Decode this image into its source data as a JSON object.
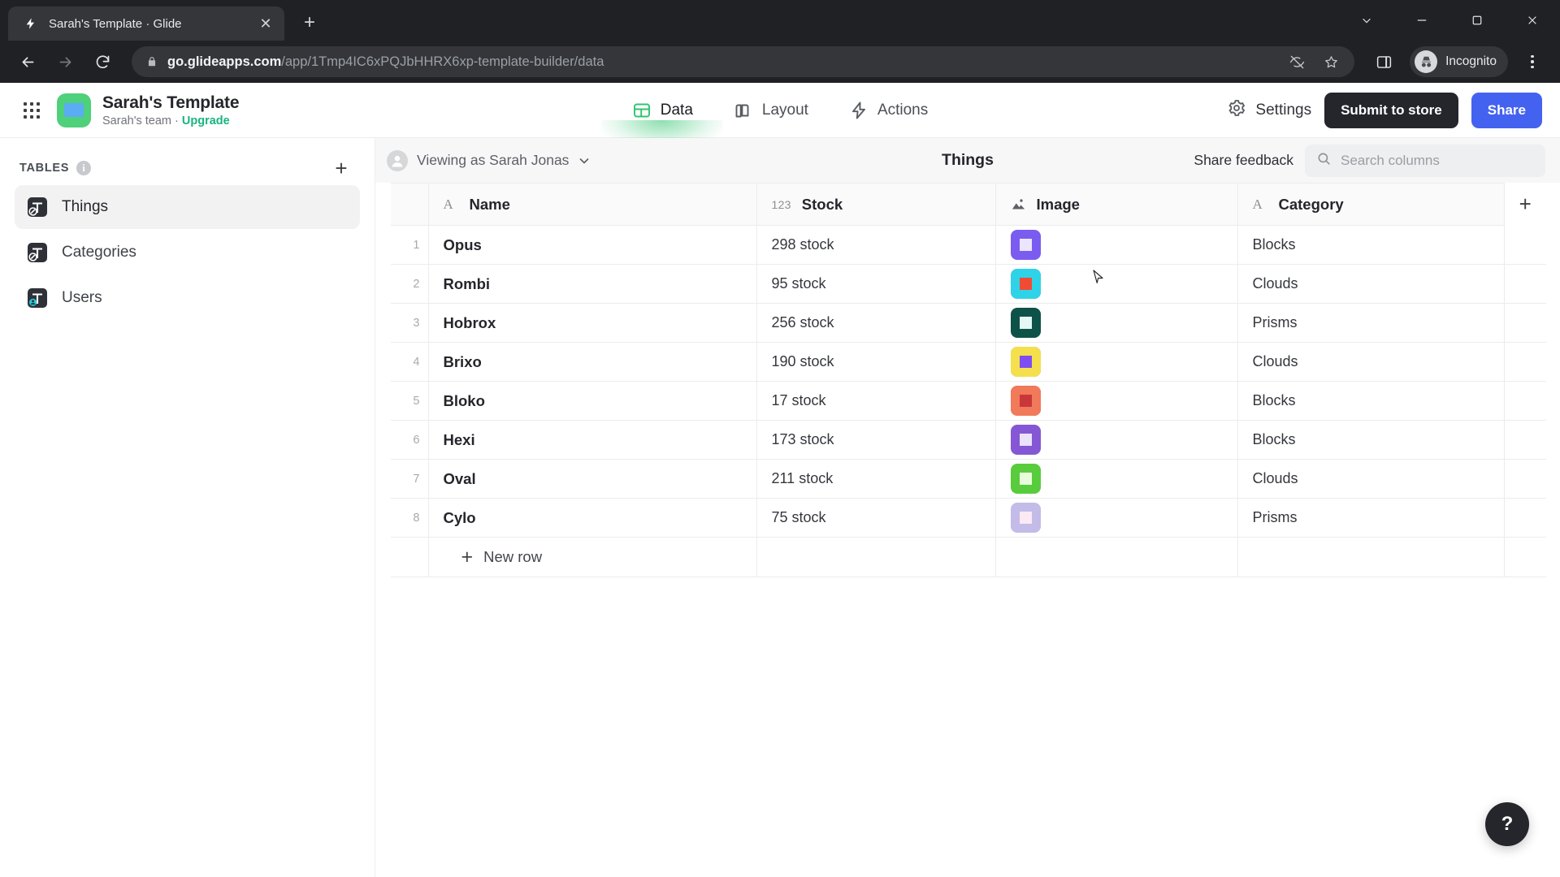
{
  "browser": {
    "tab": {
      "title": "Sarah's Template · Glide",
      "favicon": "glide-bolt-icon",
      "close_label": "✕"
    },
    "new_tab_label": "+",
    "window_controls": {
      "minimize": "minimize-icon",
      "maximize": "maximize-icon",
      "close": "close-icon",
      "expand": "expand-icon"
    },
    "url": {
      "domain": "go.glideapps.com",
      "path": "/app/1Tmp4IC6xPQJbHHRX6xp-template-builder/data"
    },
    "profile": {
      "label": "Incognito"
    },
    "colors": {
      "chrome_bg": "#202124",
      "omnibox_bg": "#35363a"
    }
  },
  "app_header": {
    "title": "Sarah's Template",
    "team": "Sarah's team",
    "separator": "·",
    "upgrade": "Upgrade",
    "nav_tabs": [
      {
        "label": "Data",
        "icon": "data-grid-icon",
        "active": true
      },
      {
        "label": "Layout",
        "icon": "layout-icon",
        "active": false
      },
      {
        "label": "Actions",
        "icon": "lightning-bolt-icon",
        "active": false
      }
    ],
    "settings_label": "Settings",
    "submit_label": "Submit to store",
    "share_label": "Share",
    "colors": {
      "accent_green": "#2fc46e",
      "share_blue": "#4462f0",
      "dark": "#25262b"
    }
  },
  "sidebar": {
    "section_label": "TABLES",
    "info_icon": "info-icon",
    "add_label": "+",
    "items": [
      {
        "label": "Things",
        "active": true
      },
      {
        "label": "Categories",
        "active": false
      },
      {
        "label": "Users",
        "active": false
      }
    ]
  },
  "grid_topbar": {
    "viewing_as": "Viewing as Sarah Jonas",
    "table_title": "Things",
    "share_feedback": "Share feedback",
    "search_placeholder": "Search columns"
  },
  "table": {
    "columns": [
      {
        "name": "Name",
        "type_icon": "A",
        "type": "text"
      },
      {
        "name": "Stock",
        "type_icon": "123",
        "type": "number"
      },
      {
        "name": "Image",
        "type_icon": "image-icon",
        "type": "image"
      },
      {
        "name": "Category",
        "type_icon": "A",
        "type": "text"
      }
    ],
    "add_column_label": "+",
    "rows": [
      {
        "index": "1",
        "name": "Opus",
        "stock": "298 stock",
        "image_color": "#7b5cf0",
        "image_bg": "#ece6fd",
        "category": "Blocks"
      },
      {
        "index": "2",
        "name": "Rombi",
        "stock": "95 stock",
        "image_color": "#2fd3e8",
        "image_bg": "#f24b35",
        "category": "Clouds"
      },
      {
        "index": "3",
        "name": "Hobrox",
        "stock": "256 stock",
        "image_color": "#0d5249",
        "image_bg": "#e4f7f6",
        "category": "Prisms"
      },
      {
        "index": "4",
        "name": "Brixo",
        "stock": "190 stock",
        "image_color": "#f4e04d",
        "image_bg": "#7e4ef0",
        "category": "Clouds"
      },
      {
        "index": "5",
        "name": "Bloko",
        "stock": "17 stock",
        "image_color": "#f07a5a",
        "image_bg": "#c9373a",
        "category": "Blocks"
      },
      {
        "index": "6",
        "name": "Hexi",
        "stock": "173 stock",
        "image_color": "#8657d4",
        "image_bg": "#eae3f9",
        "category": "Blocks"
      },
      {
        "index": "7",
        "name": "Oval",
        "stock": "211 stock",
        "image_color": "#58cc3d",
        "image_bg": "#e9fbdd",
        "category": "Clouds"
      },
      {
        "index": "8",
        "name": "Cylo",
        "stock": "75 stock",
        "image_color": "#c3bbe8",
        "image_bg": "#fbe9f3",
        "category": "Prisms"
      }
    ],
    "new_row_label": "New row"
  },
  "help": {
    "label": "?"
  }
}
